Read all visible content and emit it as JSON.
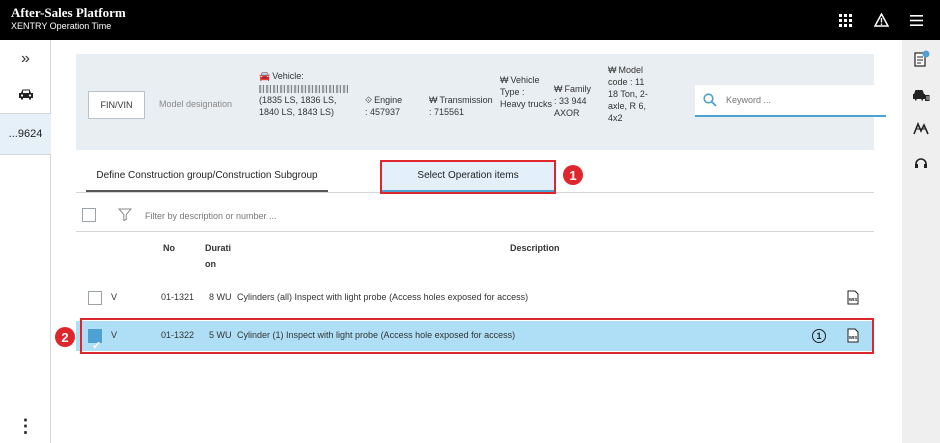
{
  "header": {
    "title": "After-Sales Platform",
    "subtitle": "XENTRY Operation Time",
    "icons": [
      "grid-icon",
      "warning-icon",
      "menu-icon"
    ]
  },
  "left_rail": {
    "collapse_glyph": "»",
    "vin_tab_label": "...9624",
    "more_glyph": "⋮"
  },
  "vehicle": {
    "fin_vin_label": "FIN/VIN",
    "model_designation_label": "Model designation",
    "vehicle_label": "Vehicle:",
    "vehicle_variants": "(1835 LS, 1836 LS, 1840 LS, 1843 LS)",
    "engine_label": "Engine",
    "engine_value": ": 457937",
    "transmission_label": "Transmission",
    "transmission_value": ": 715561",
    "vehicle_type_label": "Vehicle",
    "vehicle_type_value": "Type : Heavy trucks",
    "family_label": "Family",
    "family_value": ": 33 944 AXOR",
    "model_code_label": "Model",
    "model_code_value": "code : 11 18 Ton, 2-axle, R 6, 4x2"
  },
  "search": {
    "placeholder": "Keyword ..."
  },
  "tabs": [
    {
      "label": "Define Construction group/Construction Subgroup"
    },
    {
      "label": "Select Operation items"
    }
  ],
  "callouts": [
    "1",
    "2"
  ],
  "filter": {
    "placeholder": "Filter by description or number ..."
  },
  "table": {
    "headers": {
      "no": "No",
      "duration_line1": "Durati",
      "duration_line2": "on",
      "description": "Description"
    },
    "rows": [
      {
        "v": "V",
        "no": "01-1321",
        "duration": "8 WU",
        "description": "Cylinders (all) Inspect with light probe (Access holes exposed for access)",
        "selected": false
      },
      {
        "v": "V",
        "no": "01-1322",
        "duration": "5 WU",
        "description": "Cylinder (1) Inspect with light probe (Access hole exposed for access)",
        "selected": true
      }
    ]
  },
  "colors": {
    "header_bg": "#000000",
    "selected_row": "#aedff6",
    "accent": "#4ea1d3",
    "callout_red": "#e0262d"
  }
}
